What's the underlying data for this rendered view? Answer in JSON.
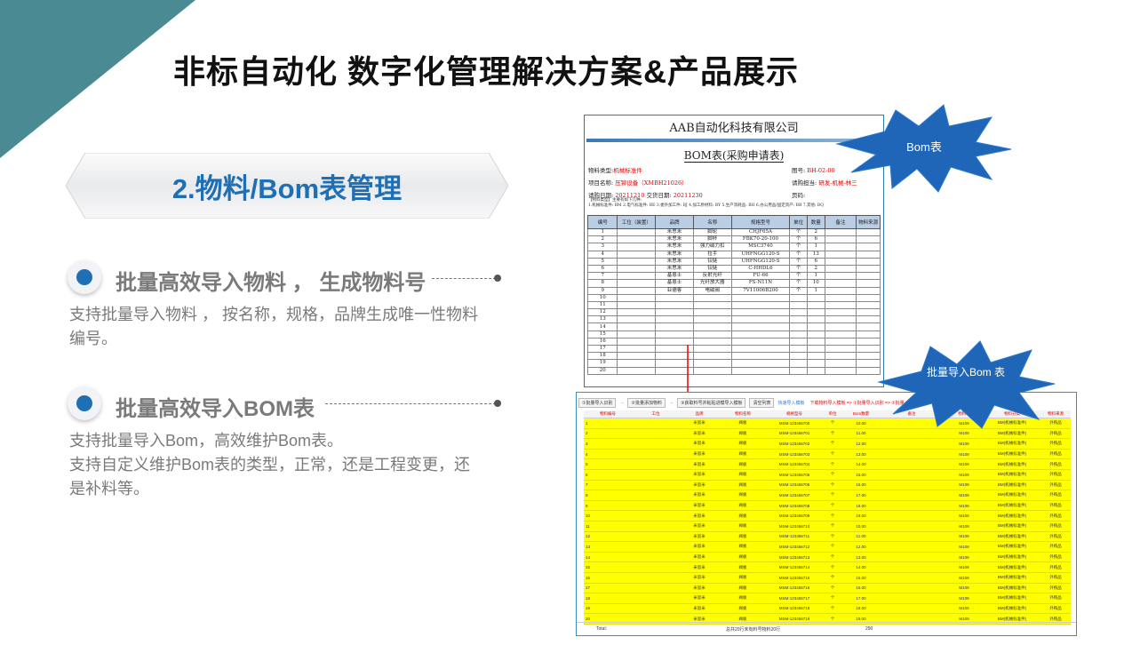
{
  "page": {
    "title": "非标自动化 数字化管理解决方案&产品展示"
  },
  "section": {
    "label": "2.物料/Bom表管理"
  },
  "features": [
    {
      "title": "批量高效导入物料 ， 生成物料号",
      "desc_lines": [
        "支持批量导入物料 ， 按名称，规格，品牌生成唯一性物料",
        "编号。"
      ]
    },
    {
      "title": "批量高效导入BOM表",
      "desc_lines": [
        "支持批量导入Bom，高效维护Bom表。",
        "支持自定义维护Bom表的类型，正常，还是工程变更，还",
        "是补料等。"
      ]
    }
  ],
  "callouts": {
    "bom": "Bom表",
    "import": "批量导入Bom 表"
  },
  "bom_form": {
    "company": "AAB自动化科技有限公司",
    "form_title": "BOM表(采购申请表)",
    "type_label": "物料类型:",
    "type_value": "机械标准件",
    "drawing_label": "图号:",
    "drawing_value": "BH-02-00",
    "project_label": "项目名称:",
    "project_value": "压铆设备（XMBH21026）",
    "date_label": "请购日期:",
    "date_value": "20211210",
    "delivery_label": "交货日期:",
    "delivery_value": "20211230",
    "requester_label": "请购担当:",
    "requester_value": "研发-机械-林三",
    "page_label": "页码:",
    "note_line1": "【物料类型】主要有如下几种:",
    "note_line2": "1.机械标准件: BM  2.电气标准件: BE  3.委外加工件: BJ  4.加工原材料: BY  5.生产消耗品: BH  6.办公用品/固定资产: BB  7.其他: BQ",
    "headers": [
      "编号",
      "工位（装置）",
      "品牌",
      "名称",
      "规格型号",
      "单位",
      "数量",
      "备注",
      "物料来源"
    ],
    "rows": [
      [
        "1",
        "",
        "米思米",
        "脚轮",
        "CHJF65A",
        "个",
        "2",
        "",
        ""
      ],
      [
        "2",
        "",
        "米思米",
        "脚杯",
        "FBK70-20-100",
        "个",
        "6",
        "",
        ""
      ],
      [
        "3",
        "",
        "米思米",
        "强力磁力扣",
        "MSC3740",
        "个",
        "1",
        "",
        ""
      ],
      [
        "4",
        "",
        "米思米",
        "拉手",
        "UHFNGG120-S",
        "个",
        "13",
        "",
        ""
      ],
      [
        "5",
        "",
        "米思米",
        "铰链",
        "UHFNGG120-S",
        "个",
        "6",
        "",
        ""
      ],
      [
        "6",
        "",
        "米思米",
        "铰链",
        "C-HHDL6",
        "个",
        "2",
        "",
        ""
      ],
      [
        "7",
        "",
        "基恩士",
        "反射光纤",
        "FU-66",
        "个",
        "1",
        "",
        ""
      ],
      [
        "8",
        "",
        "基恩士",
        "光纤放大器",
        "FS-N11N",
        "个",
        "10",
        "",
        ""
      ],
      [
        "9",
        "",
        "亚德客",
        "电磁阀",
        "7V11006B200",
        "个",
        "1",
        "",
        ""
      ],
      [
        "10",
        "",
        "",
        "",
        "",
        "",
        "",
        "",
        ""
      ],
      [
        "11",
        "",
        "",
        "",
        "",
        "",
        "",
        "",
        ""
      ],
      [
        "12",
        "",
        "",
        "",
        "",
        "",
        "",
        "",
        ""
      ],
      [
        "13",
        "",
        "",
        "",
        "",
        "",
        "",
        "",
        ""
      ],
      [
        "14",
        "",
        "",
        "",
        "",
        "",
        "",
        "",
        ""
      ],
      [
        "15",
        "",
        "",
        "",
        "",
        "",
        "",
        "",
        ""
      ],
      [
        "16",
        "",
        "",
        "",
        "",
        "",
        "",
        "",
        ""
      ],
      [
        "17",
        "",
        "",
        "",
        "",
        "",
        "",
        "",
        ""
      ],
      [
        "18",
        "",
        "",
        "",
        "",
        "",
        "",
        "",
        ""
      ],
      [
        "19",
        "",
        "",
        "",
        "",
        "",
        "",
        "",
        ""
      ],
      [
        "20",
        "",
        "",
        "",
        "",
        "",
        "",
        "",
        ""
      ]
    ]
  },
  "import_app": {
    "toolbar": [
      {
        "type": "btn",
        "label": "①批量导入识别"
      },
      {
        "type": "arrow",
        "label": "→"
      },
      {
        "type": "btn",
        "label": "②批量添加物料"
      },
      {
        "type": "arrow",
        "label": "→"
      },
      {
        "type": "btn",
        "label": "③获取料号并粘贴进模导入模板"
      },
      {
        "type": "btn",
        "label": "清空列表"
      },
      {
        "type": "hint",
        "cls": "blue",
        "label": "快速导入模板"
      },
      {
        "type": "hint",
        "cls": "red",
        "label": "下载物料导入模板 => ①批量导入识别 => ②批量…"
      }
    ],
    "headers": [
      "物料编号",
      "工位",
      "品牌",
      "物料名称",
      "规格型号",
      "单位",
      "Bom数量",
      "备注",
      "物料号",
      "物料分类",
      "物料来源"
    ],
    "rows": [
      [
        "1",
        "",
        "米思米",
        "阀板",
        "MSM-123456700",
        "个",
        "10.00",
        "",
        "M109",
        "BM(机械标准件)",
        "外购品"
      ],
      [
        "2",
        "",
        "米思米",
        "阀板",
        "MSM-123456701",
        "个",
        "11.00",
        "",
        "M109",
        "BM(机械标准件)",
        "外购品"
      ],
      [
        "3",
        "",
        "米思米",
        "阀板",
        "MSM-123456702",
        "个",
        "12.00",
        "",
        "M109",
        "BM(机械标准件)",
        "外购品"
      ],
      [
        "4",
        "",
        "米思米",
        "阀板",
        "MSM-123456703",
        "个",
        "13.00",
        "",
        "M109",
        "BM(机械标准件)",
        "外购品"
      ],
      [
        "5",
        "",
        "米思米",
        "阀板",
        "MSM-123456704",
        "个",
        "14.00",
        "",
        "M109",
        "BM(机械标准件)",
        "外购品"
      ],
      [
        "6",
        "",
        "米思米",
        "阀板",
        "MSM-123456705",
        "个",
        "15.00",
        "",
        "M109",
        "BM(机械标准件)",
        "外购品"
      ],
      [
        "7",
        "",
        "米思米",
        "阀板",
        "MSM-123456706",
        "个",
        "16.00",
        "",
        "M109",
        "BM(机械标准件)",
        "外购品"
      ],
      [
        "8",
        "",
        "米思米",
        "阀板",
        "MSM-123456707",
        "个",
        "17.00",
        "",
        "M109",
        "BM(机械标准件)",
        "外购品"
      ],
      [
        "9",
        "",
        "米思米",
        "阀板",
        "MSM-123456708",
        "个",
        "18.00",
        "",
        "M109",
        "BM(机械标准件)",
        "外购品"
      ],
      [
        "10",
        "",
        "米思米",
        "阀板",
        "MSM-123456709",
        "个",
        "19.00",
        "",
        "M109",
        "BM(机械标准件)",
        "外购品"
      ],
      [
        "11",
        "",
        "米思米",
        "阀板",
        "MSM-123456710",
        "个",
        "10.00",
        "",
        "M109",
        "BM(机械标准件)",
        "外购品"
      ],
      [
        "12",
        "",
        "米思米",
        "阀板",
        "MSM-123456711",
        "个",
        "11.00",
        "",
        "M109",
        "BM(机械标准件)",
        "外购品"
      ],
      [
        "13",
        "",
        "米思米",
        "阀板",
        "MSM-123456712",
        "个",
        "12.00",
        "",
        "M109",
        "BM(机械标准件)",
        "外购品"
      ],
      [
        "14",
        "",
        "米思米",
        "阀板",
        "MSM-123456713",
        "个",
        "13.00",
        "",
        "M109",
        "BM(机械标准件)",
        "外购品"
      ],
      [
        "15",
        "",
        "米思米",
        "阀板",
        "MSM-123456714",
        "个",
        "14.00",
        "",
        "M109",
        "BM(机械标准件)",
        "外购品"
      ],
      [
        "16",
        "",
        "米思米",
        "阀板",
        "MSM-123456715",
        "个",
        "15.00",
        "",
        "M109",
        "BM(机械标准件)",
        "外购品"
      ],
      [
        "17",
        "",
        "米思米",
        "阀板",
        "MSM-123456716",
        "个",
        "16.00",
        "",
        "M109",
        "BM(机械标准件)",
        "外购品"
      ],
      [
        "18",
        "",
        "米思米",
        "阀板",
        "MSM-123456717",
        "个",
        "17.00",
        "",
        "M109",
        "BM(机械标准件)",
        "外购品"
      ],
      [
        "19",
        "",
        "米思米",
        "阀板",
        "MSM-123456718",
        "个",
        "18.00",
        "",
        "M109",
        "BM(机械标准件)",
        "外购品"
      ],
      [
        "20",
        "",
        "米思米",
        "阀板",
        "MSM-123456719",
        "个",
        "19.00",
        "",
        "M109",
        "BM(机械标准件)",
        "外购品"
      ]
    ],
    "footer": {
      "total_label": "Total:",
      "summary": "总共20行未有料号物料20行",
      "sum": "290"
    }
  },
  "colors": {
    "accent": "#1f6fb4",
    "teal": "#4a8a92",
    "star": "#1f66b8",
    "row_yellow": "#ffff00"
  }
}
